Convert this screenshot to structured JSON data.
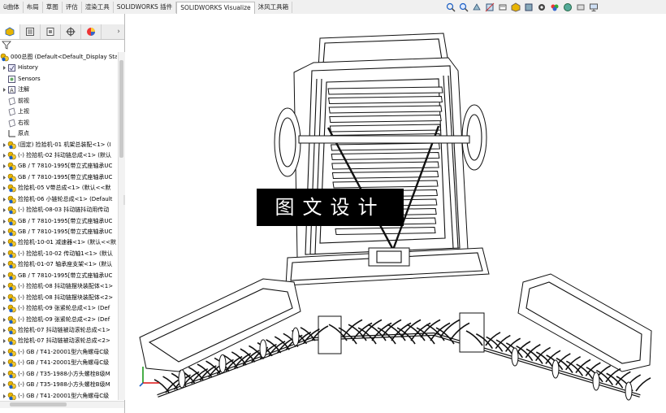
{
  "tabs": [
    {
      "label": "ü曲体"
    },
    {
      "label": "布局"
    },
    {
      "label": "草图"
    },
    {
      "label": "评估"
    },
    {
      "label": "渲染工具"
    },
    {
      "label": "SOLIDWORKS 插件"
    },
    {
      "label": "SOLIDWORKS Visualize",
      "active": true
    },
    {
      "label": "沐风工具箱"
    }
  ],
  "toolbar_icons": [
    "zoom-to-fit-icon",
    "zoom-area-icon",
    "previous-view-icon",
    "section-view-icon",
    "dynamic-annotation-icon",
    "view-orientation-icon",
    "display-style-icon",
    "hide-show-icon",
    "edit-appearance-icon",
    "scene-icon",
    "view-settings-icon",
    "monitor-icon"
  ],
  "panel_tabs": [
    "feature-manager-icon",
    "property-manager-icon",
    "configuration-manager-icon",
    "dimxpert-icon",
    "display-manager-icon"
  ],
  "tree": {
    "root": "000总图  (Default<Default_Display Sta",
    "items": [
      {
        "label": "History",
        "icon": "history-icon",
        "expand": true
      },
      {
        "label": "Sensors",
        "icon": "sensors-icon",
        "expand": false
      },
      {
        "label": "注解",
        "icon": "annotations-icon",
        "expand": true
      },
      {
        "label": "前视",
        "icon": "plane-icon",
        "expand": false
      },
      {
        "label": "上视",
        "icon": "plane-icon",
        "expand": false
      },
      {
        "label": "右视",
        "icon": "plane-icon",
        "expand": false
      },
      {
        "label": "原点",
        "icon": "origin-icon",
        "expand": false
      },
      {
        "label": "(固定) 捡拾机-01 机架总装配<1> (I",
        "icon": "assembly-icon",
        "expand": true
      },
      {
        "label": "(-) 捡拾机-02 抖动链总成<1> (默认",
        "icon": "assembly-icon",
        "expand": true
      },
      {
        "label": "GB / T 7810-1995[带立式座轴承UC",
        "icon": "assembly-icon",
        "expand": true
      },
      {
        "label": "GB / T 7810-1995[带立式座轴承UC",
        "icon": "assembly-icon",
        "expand": true
      },
      {
        "label": "捡拾机-05 V带总成<1> (默认<<默",
        "icon": "assembly-icon",
        "expand": true
      },
      {
        "label": "捡拾机-06 小链轮总成<1> (Default",
        "icon": "assembly-icon",
        "expand": true
      },
      {
        "label": "(-) 捡拾机-08-03 抖动链抖动用传动",
        "icon": "assembly-icon",
        "expand": true
      },
      {
        "label": "GB / T 7810-1995[带立式座轴承UC",
        "icon": "assembly-icon",
        "expand": true
      },
      {
        "label": "GB / T 7810-1995[带立式座轴承UC",
        "icon": "assembly-icon",
        "expand": true
      },
      {
        "label": "捡拾机-10-01 减速器<1> (默认<<默",
        "icon": "assembly-icon",
        "expand": true
      },
      {
        "label": "(-) 捡拾机-10-02 传动轴1<1> (默认",
        "icon": "assembly-icon",
        "expand": true
      },
      {
        "label": "捡拾机-01-07 轴承座支架<1> (默认",
        "icon": "assembly-icon",
        "expand": true
      },
      {
        "label": "GB / T 7810-1995[带立式座轴承UC",
        "icon": "assembly-icon",
        "expand": true
      },
      {
        "label": "(-) 捡拾机-08 抖动链摆块装配体<1>",
        "icon": "assembly-icon",
        "expand": true
      },
      {
        "label": "(-) 捡拾机-08 抖动链摆块装配体<2>",
        "icon": "assembly-icon",
        "expand": true
      },
      {
        "label": "(-) 捡拾机-09 张紧轮总成<1> (Def",
        "icon": "assembly-icon",
        "expand": true
      },
      {
        "label": "(-) 捡拾机-09 张紧轮总成<2> (Def",
        "icon": "assembly-icon",
        "expand": true
      },
      {
        "label": "捡拾机-07 抖动链被动滚轮总成<1>",
        "icon": "assembly-icon",
        "expand": true
      },
      {
        "label": "捡拾机-07 抖动链被动滚轮总成<2>",
        "icon": "assembly-icon",
        "expand": true
      },
      {
        "label": "(-) GB / T41-20001型六角螺母C级",
        "icon": "part-icon",
        "expand": true
      },
      {
        "label": "(-) GB / T41-20001型六角螺母C级",
        "icon": "part-icon",
        "expand": true
      },
      {
        "label": "(-) GB / T35-1988小方头螺栓B级M",
        "icon": "part-icon",
        "expand": true
      },
      {
        "label": "(-) GB / T35-1988小方头螺栓B级M",
        "icon": "part-icon",
        "expand": true
      },
      {
        "label": "(-) GB / T41-20001型六角螺母C级",
        "icon": "part-icon",
        "expand": true
      }
    ]
  },
  "watermark": "图文设计",
  "colors": {
    "accent": "#1b5fc4",
    "toolbar_bg": "#f0f0f0",
    "assembly_yellow": "#e8b400"
  }
}
